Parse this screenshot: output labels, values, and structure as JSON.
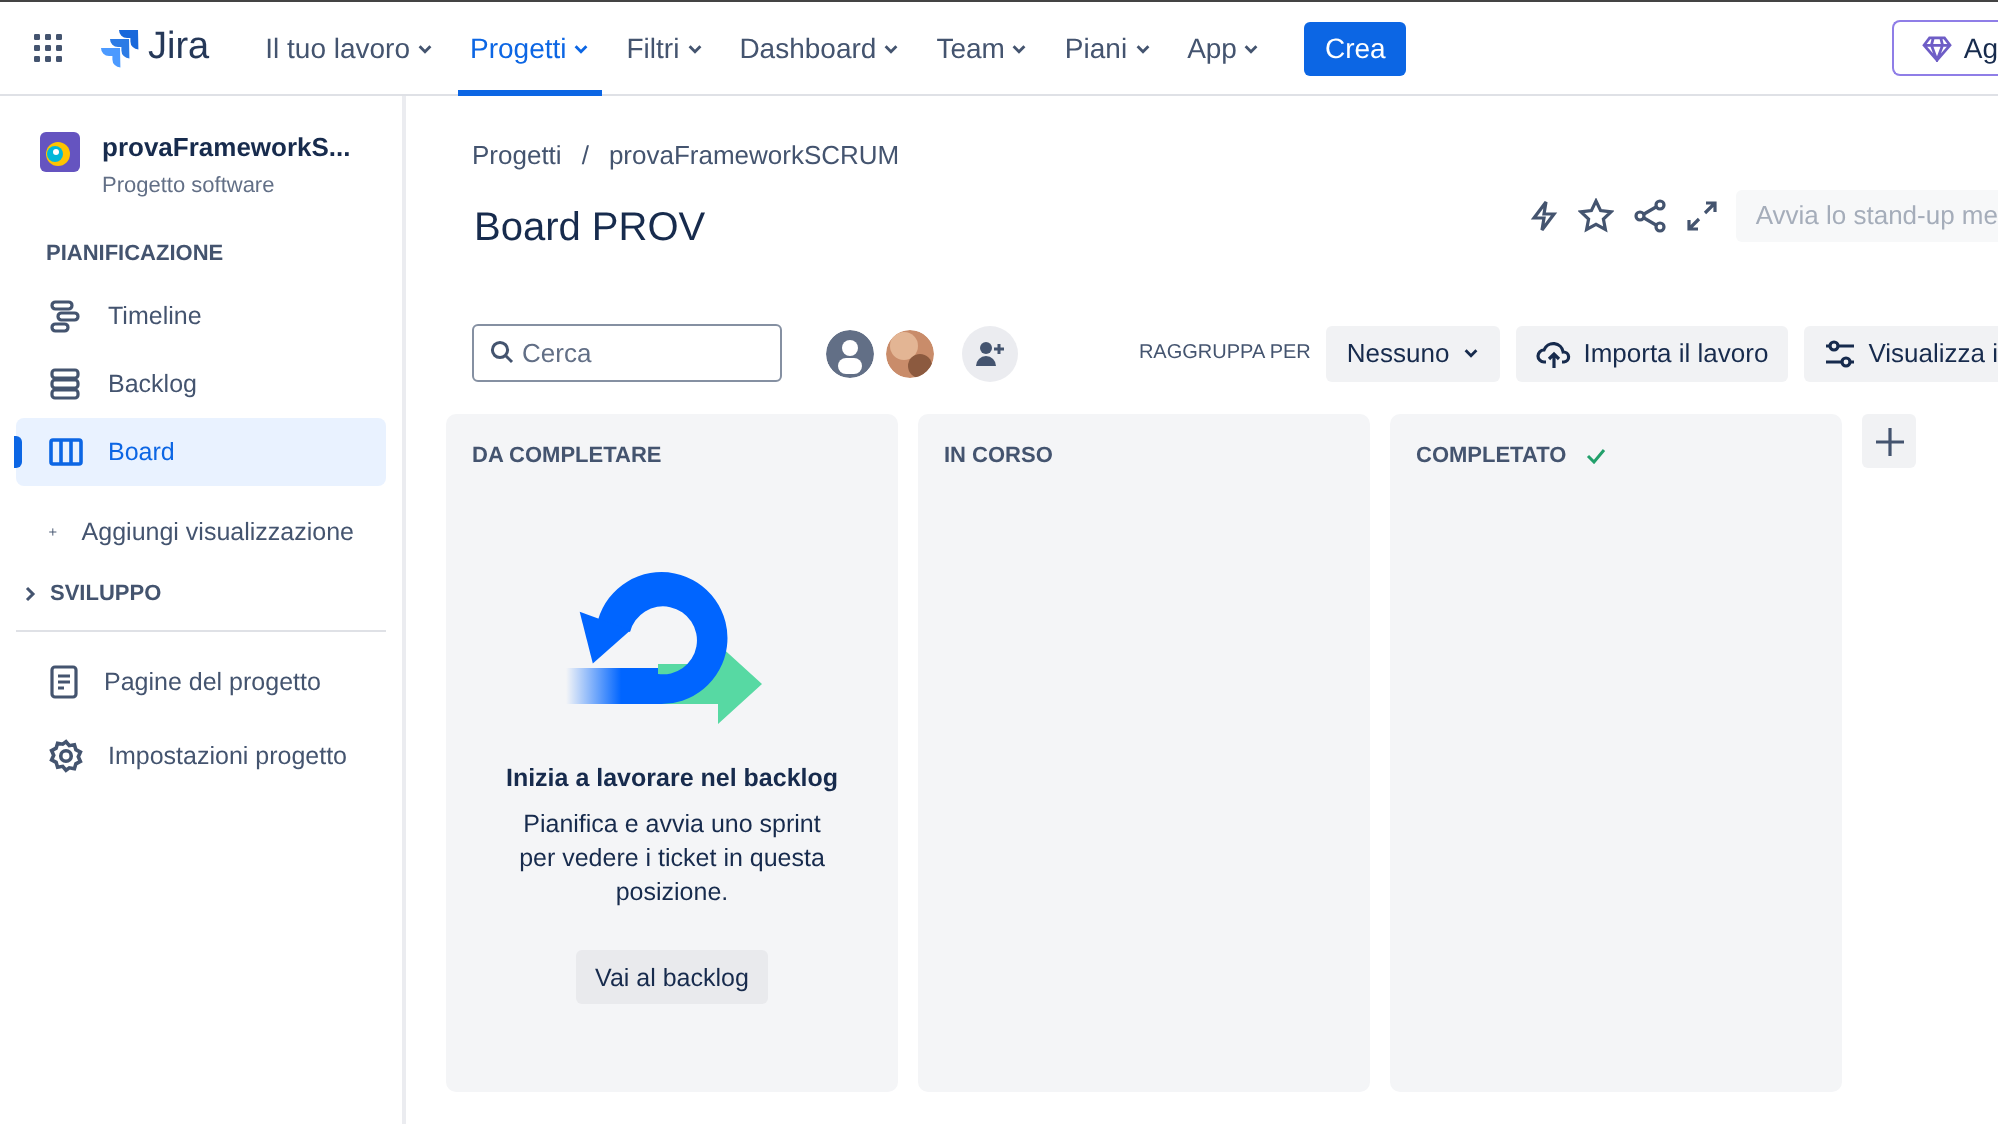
{
  "topnav": {
    "product": "Jira",
    "menus": [
      {
        "label": "Il tuo lavoro",
        "selected": false
      },
      {
        "label": "Progetti",
        "selected": true
      },
      {
        "label": "Filtri",
        "selected": false
      },
      {
        "label": "Dashboard",
        "selected": false
      },
      {
        "label": "Team",
        "selected": false
      },
      {
        "label": "Piani",
        "selected": false
      },
      {
        "label": "App",
        "selected": false
      }
    ],
    "create_button": "Crea",
    "upgrade_button": "Ag"
  },
  "sidebar": {
    "project": {
      "name": "provaFrameworkS...",
      "type": "Progetto software"
    },
    "section": "PIANIFICAZIONE",
    "items": [
      {
        "label": "Timeline",
        "selected": false
      },
      {
        "label": "Backlog",
        "selected": false
      },
      {
        "label": "Board",
        "selected": true
      }
    ],
    "add_view": "Aggiungi visualizzazione",
    "collapsed_section": {
      "label": "SVILUPPO",
      "expanded": false
    },
    "footer_items": [
      {
        "label": "Pagine del progetto"
      },
      {
        "label": "Impostazioni progetto"
      }
    ]
  },
  "breadcrumbs": [
    "Progetti",
    "provaFrameworkSCRUM"
  ],
  "breadcrumb_separator": "/",
  "title": "Board PROV",
  "standup_button": "Avvia lo stand-up me",
  "toolbar": {
    "search": {
      "placeholder": "Cerca"
    },
    "group_by_label": "RAGGRUPPA PER",
    "group_by_value": "Nessuno",
    "import_button": "Importa il lavoro",
    "view_button": "Visualizza i"
  },
  "columns": [
    {
      "title": "DA COMPLETARE",
      "done": false,
      "empty_state": {
        "heading": "Inizia a lavorare nel backlog",
        "text": "Pianifica e avvia uno sprint per vedere i ticket in questa posizione.",
        "button": "Vai al backlog"
      }
    },
    {
      "title": "IN CORSO",
      "done": false
    },
    {
      "title": "COMPLETATO",
      "done": true
    }
  ]
}
